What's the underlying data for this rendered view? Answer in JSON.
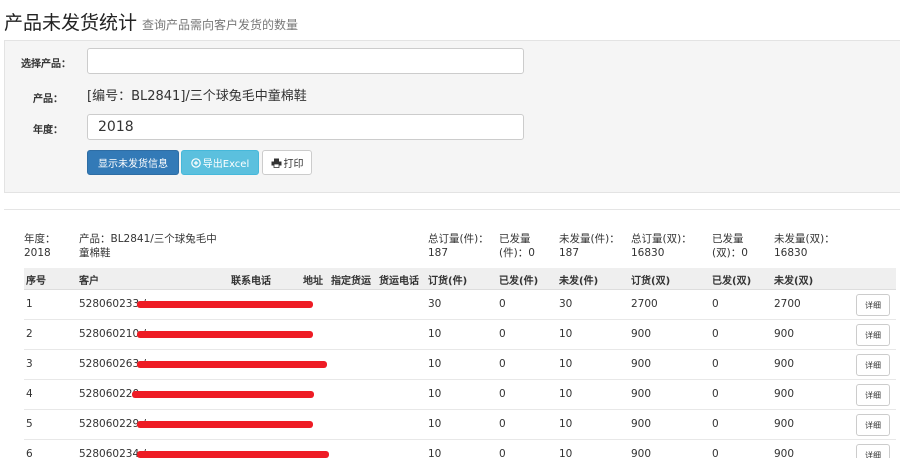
{
  "page": {
    "title": "产品未发货统计",
    "subtitle": "查询产品需向客户发货的数量"
  },
  "form": {
    "product_select_label": "选择产品：",
    "product_select_value": "",
    "product_label": "产品：",
    "product_value": "[编号：BL2841]/三个球兔毛中童棉鞋",
    "year_label": "年度：",
    "year_value": "2018",
    "show_button": "显示未发货信息",
    "export_button": "导出Excel",
    "print_button": "打印"
  },
  "summary": {
    "year_label": "年度：",
    "year_value": "2018",
    "product_line1": "产品：BL2841/三个球兔毛中",
    "product_line2": "童棉鞋",
    "total_order_pcs_label": "总订量(件)：",
    "total_order_pcs_value": "187",
    "shipped_pcs_label_1": "已发量",
    "shipped_pcs_label_2": "(件)：0",
    "unshipped_pcs_label": "未发量(件)：",
    "unshipped_pcs_value": "187",
    "total_order_pairs_label": "总订量(双)：",
    "total_order_pairs_value": "16830",
    "shipped_pairs_label_1": "已发量",
    "shipped_pairs_label_2": "(双)：0",
    "unshipped_pairs_label": "未发量(双)：",
    "unshipped_pairs_value": "16830"
  },
  "table": {
    "headers": [
      "序号",
      "客户",
      "联系电话",
      "地址",
      "指定货运",
      "货运电话",
      "订货(件)",
      "已发(件)",
      "未发(件)",
      "订货(双)",
      "已发(双)",
      "未发(双)"
    ],
    "detail_label": "详细",
    "rows": [
      {
        "no": "1",
        "customer": "528060233 /",
        "order_pcs": "30",
        "shipped_pcs": "0",
        "unshipped_pcs": "30",
        "order_pairs": "2700",
        "shipped_pairs": "0",
        "unshipped_pairs": "2700"
      },
      {
        "no": "2",
        "customer": "528060210 /",
        "order_pcs": "10",
        "shipped_pcs": "0",
        "unshipped_pcs": "10",
        "order_pairs": "900",
        "shipped_pairs": "0",
        "unshipped_pairs": "900"
      },
      {
        "no": "3",
        "customer": "528060263 /",
        "order_pcs": "10",
        "shipped_pcs": "0",
        "unshipped_pcs": "10",
        "order_pairs": "900",
        "shipped_pairs": "0",
        "unshipped_pairs": "900"
      },
      {
        "no": "4",
        "customer": "528060220",
        "order_pcs": "10",
        "shipped_pcs": "0",
        "unshipped_pcs": "10",
        "order_pairs": "900",
        "shipped_pairs": "0",
        "unshipped_pairs": "900"
      },
      {
        "no": "5",
        "customer": "528060229 /",
        "order_pcs": "10",
        "shipped_pcs": "0",
        "unshipped_pcs": "10",
        "order_pairs": "900",
        "shipped_pairs": "0",
        "unshipped_pairs": "900"
      },
      {
        "no": "6",
        "customer": "528060234 /",
        "order_pcs": "10",
        "shipped_pcs": "0",
        "unshipped_pcs": "10",
        "order_pairs": "900",
        "shipped_pairs": "0",
        "unshipped_pairs": "900"
      }
    ]
  },
  "colors": {
    "primary": "#337ab7",
    "info": "#5bc0de",
    "redaction": "#ee1c25"
  }
}
